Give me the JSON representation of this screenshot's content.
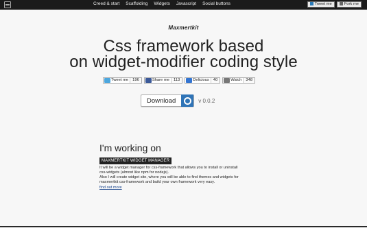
{
  "nav": {
    "items": [
      "Creed & start",
      "Scaffolding",
      "Widgets",
      "Javascript",
      "Social buttons"
    ],
    "actions": {
      "tweet": "Tweet me",
      "fork": "Fork me"
    }
  },
  "hero": {
    "brand": "Maxmertkit",
    "headline_line1": "Css framework based",
    "headline_line2": "on widget-modifier coding style"
  },
  "social": {
    "tweet": {
      "label": "Tweet me",
      "count": "196"
    },
    "share": {
      "label": "Share me",
      "count": "113"
    },
    "delicious": {
      "label": "Delicious",
      "count": "40"
    },
    "watch": {
      "label": "Watch",
      "count": "348"
    }
  },
  "download": {
    "label": "Download",
    "version": "v 0.0.2"
  },
  "working": {
    "title": "I'm working on",
    "tag": "MAXMERTKIT WIDGET MANAGER",
    "line1": "It will be a widget manager for css-framework that allows you to install or uninstall",
    "line2": "css-widgets (almost like npm for nodejs).",
    "line3": "Also I will create widget site, where you will be able to find themes and widgets for",
    "line4": "maxmertkit css-framework and build your own framework very easy.",
    "link": "find out more"
  },
  "colors": {
    "topbar": "#1b1b1b",
    "accent": "#2f74b7",
    "background": "#f7f7f7"
  }
}
